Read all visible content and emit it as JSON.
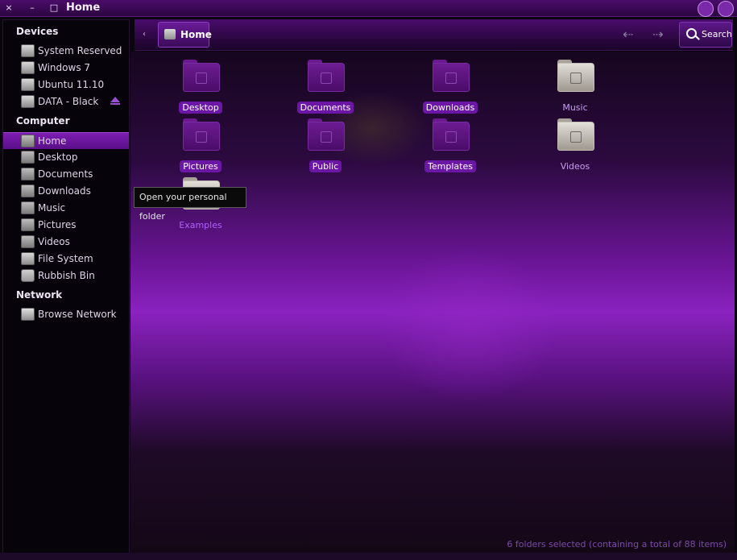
{
  "window": {
    "title": "Home",
    "close_glyph": "×",
    "min_glyph": "–",
    "max_glyph": "□"
  },
  "sidebar": {
    "devices_header": "Devices",
    "devices": [
      {
        "label": "System Reserved",
        "icon": "drive-icon"
      },
      {
        "label": "Windows 7",
        "icon": "drive-icon"
      },
      {
        "label": "Ubuntu 11.10",
        "icon": "drive-icon"
      },
      {
        "label": "DATA - Black",
        "icon": "drive-icon",
        "ejectable": true
      }
    ],
    "computer_header": "Computer",
    "places": [
      {
        "label": "Home",
        "icon": "home-folder-icon",
        "active": true
      },
      {
        "label": "Desktop",
        "icon": "desktop-folder-icon"
      },
      {
        "label": "Documents",
        "icon": "documents-folder-icon"
      },
      {
        "label": "Downloads",
        "icon": "downloads-folder-icon"
      },
      {
        "label": "Music",
        "icon": "music-folder-icon"
      },
      {
        "label": "Pictures",
        "icon": "pictures-folder-icon"
      },
      {
        "label": "Videos",
        "icon": "videos-folder-icon"
      },
      {
        "label": "File System",
        "icon": "drive-icon"
      },
      {
        "label": "Rubbish Bin",
        "icon": "trash-icon"
      }
    ],
    "network_header": "Network",
    "network": [
      {
        "label": "Browse Network",
        "icon": "network-icon"
      }
    ]
  },
  "toolbar": {
    "back_small": "‹",
    "breadcrumb": "Home",
    "nav_back": "⇠",
    "nav_forward": "⇢",
    "search_label": "Search"
  },
  "main": {
    "folders": [
      {
        "label": "Desktop",
        "selected": true
      },
      {
        "label": "Documents",
        "selected": true
      },
      {
        "label": "Downloads",
        "selected": true
      },
      {
        "label": "Music",
        "selected": false
      },
      {
        "label": "Pictures",
        "selected": true
      },
      {
        "label": "Public",
        "selected": true
      },
      {
        "label": "Templates",
        "selected": true
      },
      {
        "label": "Videos",
        "selected": false
      },
      {
        "label": "Examples",
        "selected": false
      }
    ],
    "tooltip": "Open your personal folder",
    "status": "6 folders selected (containing a total of 88 items)"
  },
  "colors": {
    "accent": "#6c16a6",
    "titlebar": "#4b0c6a",
    "sidebar_bg": "#07030a"
  }
}
